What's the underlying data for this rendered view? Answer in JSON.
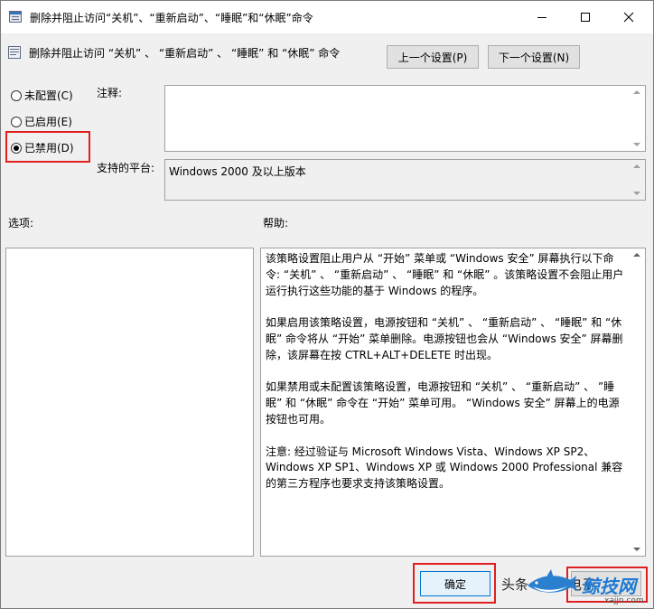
{
  "window": {
    "title": "删除并阻止访问“关机”、“重新启动”、“睡眠”和“休眠”命令"
  },
  "header": {
    "policy_title": "删除并阻止访问 “关机” 、 “重新启动” 、 “睡眠” 和 “休眠” 命令",
    "prev_label": "上一个设置(P)",
    "next_label": "下一个设置(N)"
  },
  "radios": [
    {
      "label": "未配置(C)",
      "checked": false
    },
    {
      "label": "已启用(E)",
      "checked": false
    },
    {
      "label": "已禁用(D)",
      "checked": true
    }
  ],
  "labels": {
    "comment": "注释:",
    "platform": "支持的平台:",
    "options": "选项:",
    "help": "帮助:"
  },
  "platform_value": "Windows 2000 及以上版本",
  "help_paragraphs": [
    "该策略设置阻止用户从 “开始” 菜单或 “Windows 安全” 屏幕执行以下命令: “关机” 、 “重新启动” 、 “睡眠” 和 “休眠” 。该策略设置不会阻止用户运行执行这些功能的基于 Windows 的程序。",
    "如果启用该策略设置，电源按钮和 “关机” 、 “重新启动” 、 “睡眠” 和 “休眠” 命令将从 “开始” 菜单删除。电源按钮也会从 “Windows 安全” 屏幕删除，该屏幕在按 CTRL+ALT+DELETE 时出现。",
    "如果禁用或未配置该策略设置，电源按钮和 “关机” 、 “重新启动” 、 ”睡眠” 和 “休眠” 命令在 “开始” 菜单可用。 “Windows 安全” 屏幕上的电源按钮也可用。",
    "注意: 经过验证与 Microsoft Windows Vista、Windows XP SP2、Windows XP SP1、Windows XP 或 Windows 2000 Professional 兼容的第三方程序也要求支持该策略设置。"
  ],
  "footer": {
    "ok_label": "确定"
  },
  "watermark": {
    "left_text": "头条",
    "mid_text": "电子",
    "logo_text": "鲸技网",
    "url": "xajjn.com"
  }
}
